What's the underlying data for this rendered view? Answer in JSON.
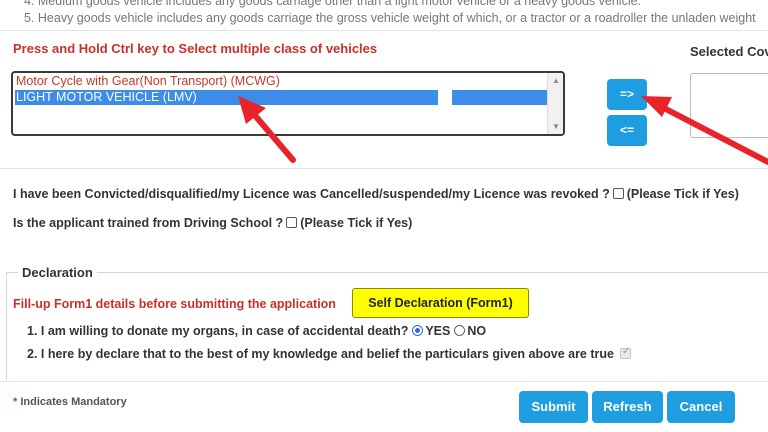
{
  "notes": {
    "note4": "4. Medium goods vehicle includes any goods carriage other than a light motor vehicle or a heavy goods vehicle.",
    "note5": "5. Heavy goods vehicle includes any goods carriage the gross vehicle weight of which, or a tractor or a roadroller the unladen weight"
  },
  "vehicle_select": {
    "hint": "Press and Hold Ctrl key to Select multiple class of vehicles",
    "options": [
      {
        "label": "Motor Cycle with Gear(Non Transport) (MCWG)",
        "selected": false
      },
      {
        "label": "LIGHT MOTOR VEHICLE (LMV)",
        "selected": true
      }
    ],
    "move_right_label": "=>",
    "move_left_label": "<=",
    "selected_title": "Selected Cov"
  },
  "questions": {
    "q1": "I have been Convicted/disqualified/my Licence was Cancelled/suspended/my Licence was revoked ?",
    "q1_hint": "(Please Tick if Yes)",
    "q2": "Is the applicant trained from Driving School ?",
    "q2_hint": "(Please Tick if Yes)"
  },
  "declaration": {
    "legend": "Declaration",
    "fill_up": "Fill-up Form1 details before submitting the application",
    "self_decl_button": "Self Declaration (Form1)",
    "item1": "1. I am willing to donate my organs, in case of accidental death?",
    "yes_label": "YES",
    "no_label": "NO",
    "item2": "2. I here by declare that to the best of my knowledge and belief the particulars given above are true"
  },
  "footer": {
    "star": "*",
    "mandatory": "Indicates Mandatory",
    "submit": "Submit",
    "refresh": "Refresh",
    "cancel": "Cancel"
  },
  "colors": {
    "accent_button": "#1e9ee0",
    "alert_text": "#c9302c",
    "highlight_option": "#3d8ce8",
    "annotation_arrow": "#e8232a",
    "self_declaration_bg": "#ffff00"
  }
}
